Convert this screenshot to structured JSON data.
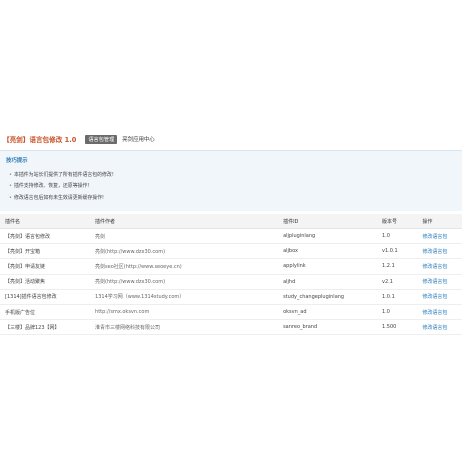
{
  "header": {
    "title": "【亮剑】语言包修改 1.0",
    "badge": "语言包管理",
    "center": "亮剑应用中心"
  },
  "tips": {
    "title": "技巧提示",
    "items": [
      "本插件为站长们提供了所有插件语言包的修改!",
      "插件支持修改、恢复，还原等操作!",
      "修改语言包后如有未生效请更新缓存操作!"
    ]
  },
  "table": {
    "headers": [
      "插件名",
      "插件作者",
      "插件ID",
      "版本号",
      "操作"
    ],
    "rows": [
      {
        "name": "【亮剑】语言包修改",
        "author": "亮剑",
        "id": "aljpluginlang",
        "version": "1.0",
        "action": "修改语言包"
      },
      {
        "name": "【亮剑】开宝箱",
        "author": "亮剑(http://www.dzx30.com)",
        "id": "aljbox",
        "version": "v1.0.1",
        "action": "修改语言包"
      },
      {
        "name": "【亮剑】申请友链",
        "author": "亮剑seo社区(http://www.seoeye.cn)",
        "id": "applylink",
        "version": "1.2.1",
        "action": "修改语言包"
      },
      {
        "name": "【亮剑】活动聚焦",
        "author": "亮剑(http://www.dzx30.com)",
        "id": "aljhd",
        "version": "v2.1",
        "action": "修改语言包"
      },
      {
        "name": "[1314]插件语言包修改",
        "author": "1314学习网（www.1314study.com）",
        "id": "study_changepluginlang",
        "version": "1.0.1",
        "action": "修改语言包"
      },
      {
        "name": "手机版广告位",
        "author": "http://smx.oksvn.com",
        "id": "oksvn_ad",
        "version": "1.0",
        "action": "修改语言包"
      },
      {
        "name": "【三楼】品牌123【网】",
        "author": "淮青市三楼网络科技有限公司",
        "id": "sanreo_brand",
        "version": "1.500",
        "action": "修改语言包"
      }
    ]
  }
}
